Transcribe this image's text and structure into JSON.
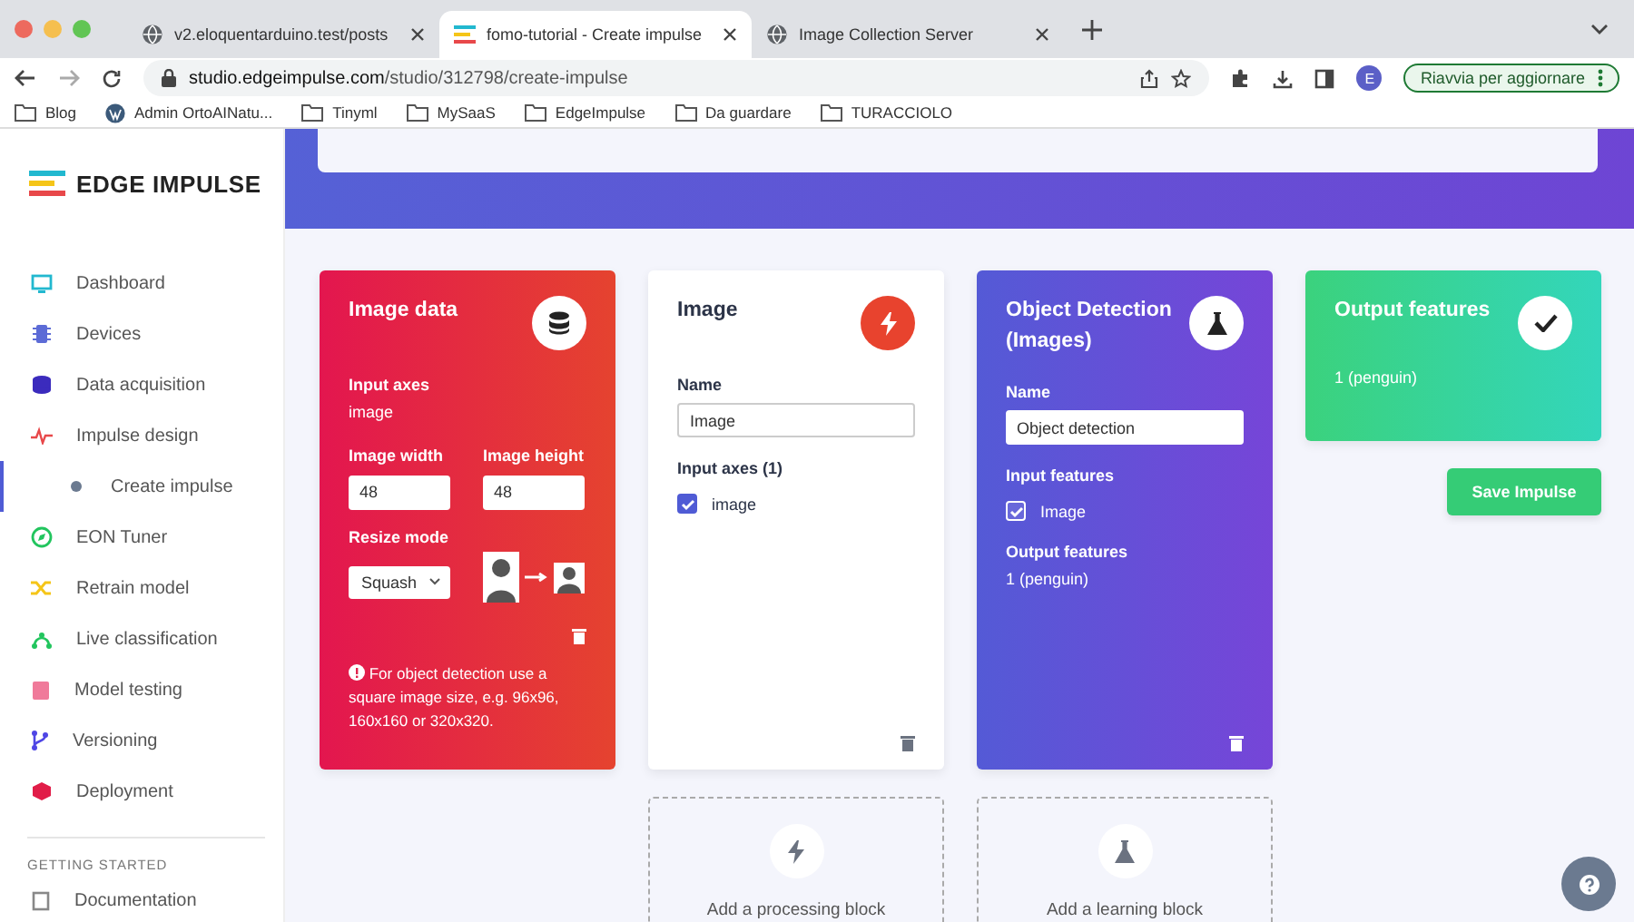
{
  "browser": {
    "tabs": [
      {
        "title": "v2.eloquentarduino.test/posts",
        "kind": "globe",
        "selected": false
      },
      {
        "title": "fomo-tutorial - Create impulse",
        "kind": "logo",
        "selected": true
      },
      {
        "title": "Image Collection Server",
        "kind": "globe",
        "selected": false
      }
    ],
    "url": {
      "host": "studio.edgeimpulse.com",
      "path": "/studio/312798/create-impulse"
    },
    "profile": "E",
    "update_button": "Riavvia per aggiornare",
    "bookmarks": [
      {
        "label": "Blog",
        "kind": "folder"
      },
      {
        "label": "Admin OrtoAINatu...",
        "kind": "wp"
      },
      {
        "label": "Tinyml",
        "kind": "folder"
      },
      {
        "label": "MySaaS",
        "kind": "folder"
      },
      {
        "label": "EdgeImpulse",
        "kind": "folder"
      },
      {
        "label": "Da guardare",
        "kind": "folder"
      },
      {
        "label": "TURACCIOLO",
        "kind": "folder"
      }
    ]
  },
  "sidebar": {
    "logo": "EDGE IMPULSE",
    "items": [
      {
        "label": "Dashboard",
        "selected": false
      },
      {
        "label": "Devices",
        "selected": false
      },
      {
        "label": "Data acquisition",
        "selected": false
      },
      {
        "label": "Impulse design",
        "selected": false,
        "children": [
          {
            "label": "Create impulse",
            "selected": true
          }
        ]
      },
      {
        "label": "EON Tuner",
        "selected": false
      },
      {
        "label": "Retrain model",
        "selected": false
      },
      {
        "label": "Live classification",
        "selected": false
      },
      {
        "label": "Model testing",
        "selected": false
      },
      {
        "label": "Versioning",
        "selected": false
      },
      {
        "label": "Deployment",
        "selected": false
      }
    ],
    "section_heading": "GETTING STARTED",
    "section_items": [
      {
        "label": "Documentation",
        "selected": false
      }
    ]
  },
  "image_data": {
    "title": "Image data",
    "input_axes_label": "Input axes",
    "input_axes_value": "image",
    "width_label": "Image width",
    "width_value": "48",
    "height_label": "Image height",
    "height_value": "48",
    "resize_label": "Resize mode",
    "resize_value": "Squash",
    "note": "For object detection use a square image size, e.g. 96x96, 160x160 or 320x320."
  },
  "processing_block": {
    "title": "Image",
    "name_label": "Name",
    "name_value": "Image",
    "axes_label": "Input axes (1)",
    "axes": [
      {
        "label": "image",
        "checked": true
      }
    ]
  },
  "learning_block": {
    "title": "Object Detection (Images)",
    "name_label": "Name",
    "name_value": "Object detection",
    "inputs_label": "Input features",
    "inputs": [
      {
        "label": "Image",
        "checked": true
      }
    ],
    "outputs_label": "Output features",
    "outputs_value": "1 (penguin)"
  },
  "output_block": {
    "title": "Output features",
    "value": "1 (penguin)"
  },
  "save_button": "Save Impulse",
  "add_blocks": [
    {
      "kind": "processing",
      "label": "Add a processing block"
    },
    {
      "kind": "learning",
      "label": "Add a learning block"
    }
  ]
}
